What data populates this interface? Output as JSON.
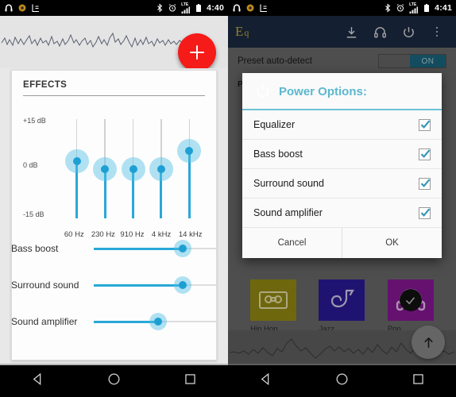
{
  "left": {
    "statusbar": {
      "time": "4:40",
      "left_icons": [
        "headphones-icon",
        "record-icon",
        "app-icon"
      ],
      "right_icons": [
        "bluetooth-icon",
        "alarm-icon",
        "lte-signal-icon",
        "battery-icon"
      ],
      "lte_label": "LTE"
    },
    "fab_add_label": "+",
    "card_title": "EFFECTS",
    "equalizer": {
      "scale_top": "+15 dB",
      "scale_mid": "0 dB",
      "scale_bottom": "-15 dB",
      "bands": [
        {
          "freq": "60 Hz",
          "value_pct": 58
        },
        {
          "freq": "230 Hz",
          "value_pct": 50
        },
        {
          "freq": "910 Hz",
          "value_pct": 50
        },
        {
          "freq": "4 kHz",
          "value_pct": 50
        },
        {
          "freq": "14 kHz",
          "value_pct": 68
        }
      ]
    },
    "effect_rows": [
      {
        "label": "Bass boost",
        "value_pct": 72
      },
      {
        "label": "Surround sound",
        "value_pct": 72
      },
      {
        "label": "Sound amplifier",
        "value_pct": 52
      }
    ],
    "navbar": [
      "back-icon",
      "home-icon",
      "recents-icon"
    ]
  },
  "right": {
    "statusbar": {
      "time": "4:41",
      "lte_label": "LTE"
    },
    "appbar": {
      "logo_main": "E",
      "logo_sub": "q",
      "icons": [
        "download-icon",
        "headphones-icon",
        "power-icon",
        "overflow-menu-icon"
      ]
    },
    "auto_detect": {
      "label": "Preset auto-detect",
      "toggle_state": "ON"
    },
    "presets_header": "PRESETS",
    "tiles": [
      {
        "label": "Hip Hop",
        "icon": "cassette-icon",
        "color": "#9a8f12",
        "selected": false
      },
      {
        "label": "Jazz",
        "icon": "saxophone-icon",
        "color": "#2b1b9e",
        "selected": false
      },
      {
        "label": "Pop",
        "icon": "headphones-icon",
        "color": "#8d189b",
        "selected": true
      }
    ],
    "fab_scroll_top": "up-arrow-icon",
    "dialog": {
      "title": "Power Options:",
      "icon": "power-icon",
      "items": [
        {
          "label": "Equalizer",
          "checked": true
        },
        {
          "label": "Bass boost",
          "checked": true
        },
        {
          "label": "Surround sound",
          "checked": true
        },
        {
          "label": "Sound amplifier",
          "checked": true
        }
      ],
      "cancel_label": "Cancel",
      "ok_label": "OK"
    },
    "navbar": [
      "back-icon",
      "home-icon",
      "recents-icon"
    ]
  },
  "colors": {
    "accent_blue": "#29a8d8",
    "fab_red": "#f51b19",
    "appbar_navy": "#1d2b45",
    "dialog_teal": "#5bb8cf",
    "logo_gold": "#c9b23c"
  }
}
